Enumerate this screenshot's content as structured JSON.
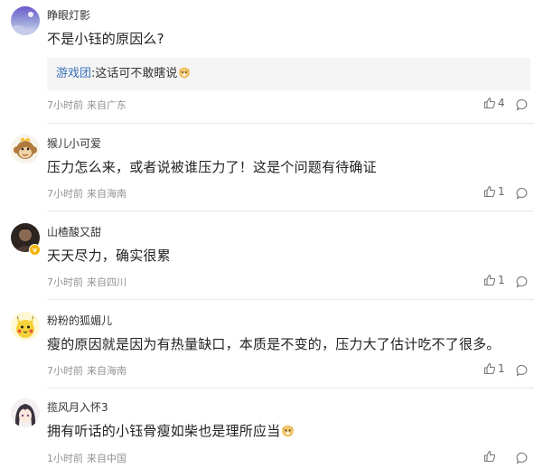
{
  "comments": [
    {
      "username": "睁眼灯影",
      "text": "不是小钰的原因么?",
      "reply": {
        "name": "游戏团",
        "sep": ":",
        "text": "这话可不敢瞎说"
      },
      "time": "7小时前",
      "location": "来自广东",
      "likes": "4",
      "avatar": "avatar-sky"
    },
    {
      "username": "猴儿小可爱",
      "text": "压力怎么来，或者说被谁压力了！这是个问题有待确证",
      "time": "7小时前",
      "location": "来自海南",
      "likes": "1",
      "avatar": "avatar-monkey"
    },
    {
      "username": "山楂酸又甜",
      "text": "天天尽力，确实很累",
      "time": "7小时前",
      "location": "来自四川",
      "likes": "1",
      "avatar": "avatar-dark-photo",
      "verified": true
    },
    {
      "username": "粉粉的狐媚儿",
      "text": "瘦的原因就是因为有热量缺口，本质是不变的，压力大了估计吃不了很多。",
      "time": "7小时前",
      "location": "来自海南",
      "likes": "1",
      "avatar": "avatar-pikachu"
    },
    {
      "username": "揽风月入怀3",
      "text": "拥有听话的小钰骨瘦如柴也是理所应当",
      "time": "1小时前",
      "location": "来自中国",
      "likes": "",
      "avatar": "avatar-anime"
    }
  ],
  "verified_badge": "v",
  "colors": {
    "reply_name": "#3a6fb6",
    "meta": "#939393",
    "reply_bg": "#f5f5f5",
    "divider": "#e8e8e8",
    "badge": "#f5b400"
  }
}
